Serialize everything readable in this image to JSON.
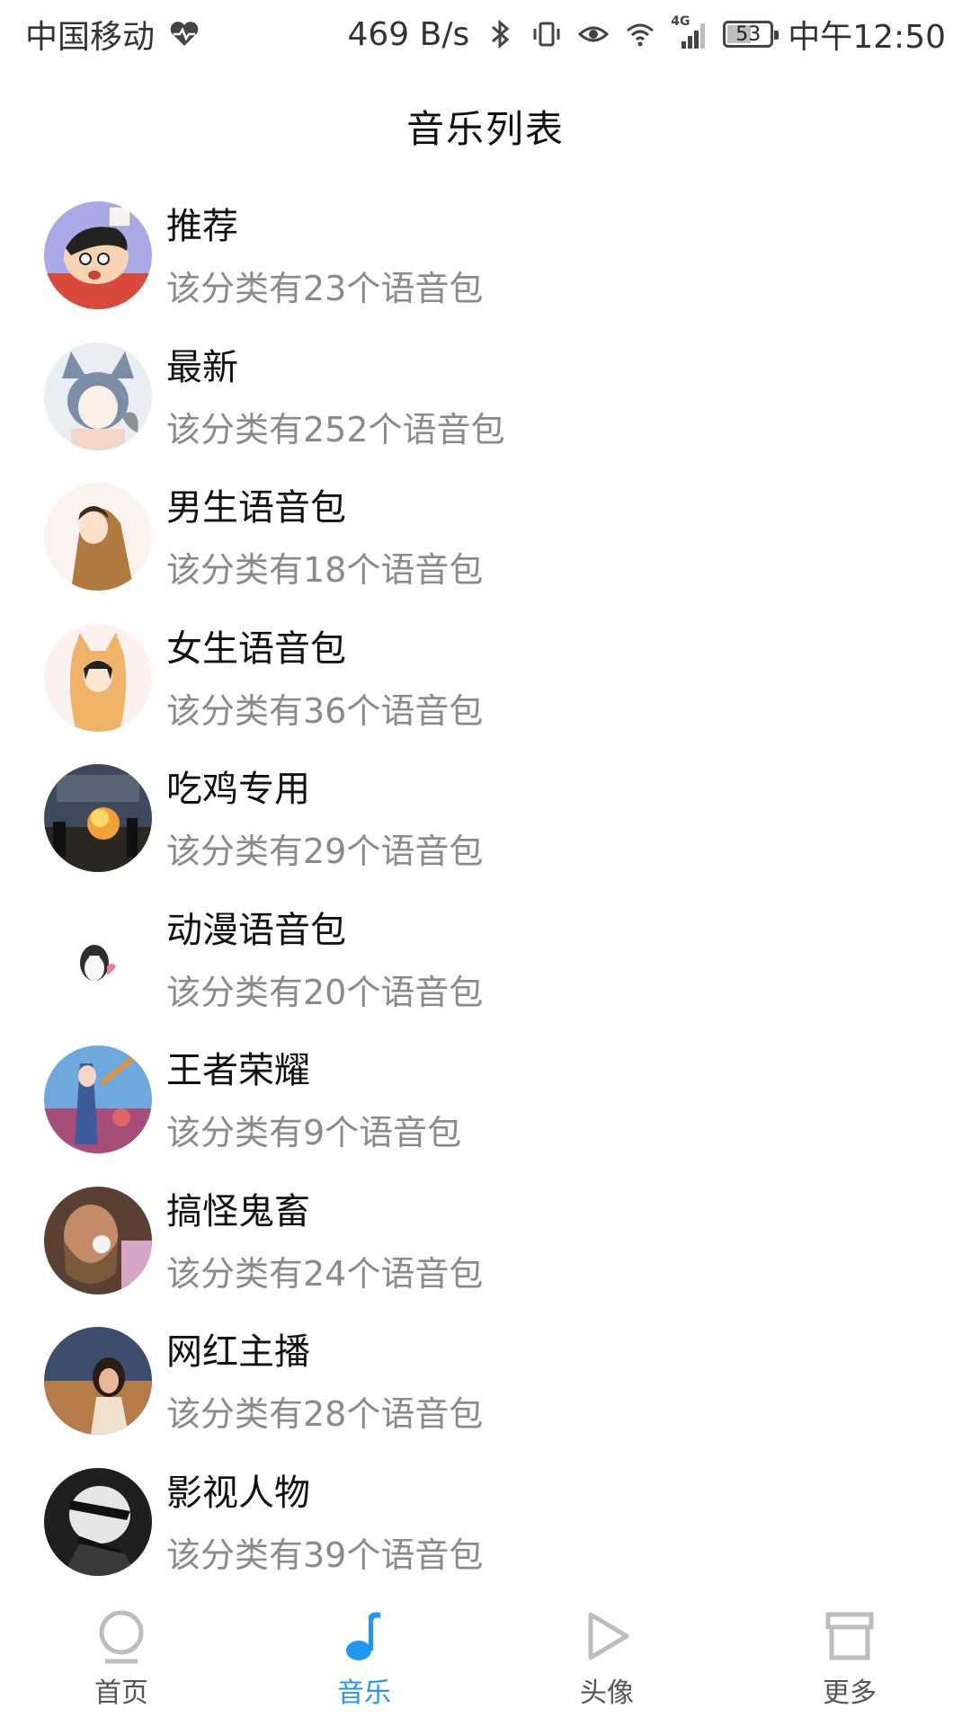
{
  "status_bar": {
    "carrier": "中国移动",
    "speed": "469 B/s",
    "network": "4G",
    "battery": "53",
    "time": "中午12:50"
  },
  "header": {
    "title": "音乐列表"
  },
  "list": [
    {
      "title": "推荐",
      "subtitle": "该分类有23个语音包",
      "avatar": "cartoon-boy-avatar"
    },
    {
      "title": "最新",
      "subtitle": "该分类有252个语音包",
      "avatar": "anime-cat-girl-avatar"
    },
    {
      "title": "男生语音包",
      "subtitle": "该分类有18个语音包",
      "avatar": "hooded-boy-avatar"
    },
    {
      "title": "女生语音包",
      "subtitle": "该分类有36个语音包",
      "avatar": "fox-hood-girl-avatar"
    },
    {
      "title": "吃鸡专用",
      "subtitle": "该分类有29个语音包",
      "avatar": "game-scene-avatar"
    },
    {
      "title": "动漫语音包",
      "subtitle": "该分类有20个语音包",
      "avatar": "penguin-avatar"
    },
    {
      "title": "王者荣耀",
      "subtitle": "该分类有9个语音包",
      "avatar": "game-hero-avatar"
    },
    {
      "title": "搞怪鬼畜",
      "subtitle": "该分类有24个语音包",
      "avatar": "funny-man-avatar"
    },
    {
      "title": "网红主播",
      "subtitle": "该分类有28个语音包",
      "avatar": "girl-photo-avatar"
    },
    {
      "title": "影视人物",
      "subtitle": "该分类有39个语音包",
      "avatar": "bw-character-avatar"
    }
  ],
  "bottom_nav": [
    {
      "label": "首页",
      "icon": "circle-home-icon",
      "active": false
    },
    {
      "label": "音乐",
      "icon": "music-note-icon",
      "active": true
    },
    {
      "label": "头像",
      "icon": "play-triangle-icon",
      "active": false
    },
    {
      "label": "更多",
      "icon": "box-more-icon",
      "active": false
    }
  ],
  "colors": {
    "accent": "#2196f3",
    "subtitle": "#8a8a8a",
    "nav_inactive": "#bdbdbd"
  }
}
